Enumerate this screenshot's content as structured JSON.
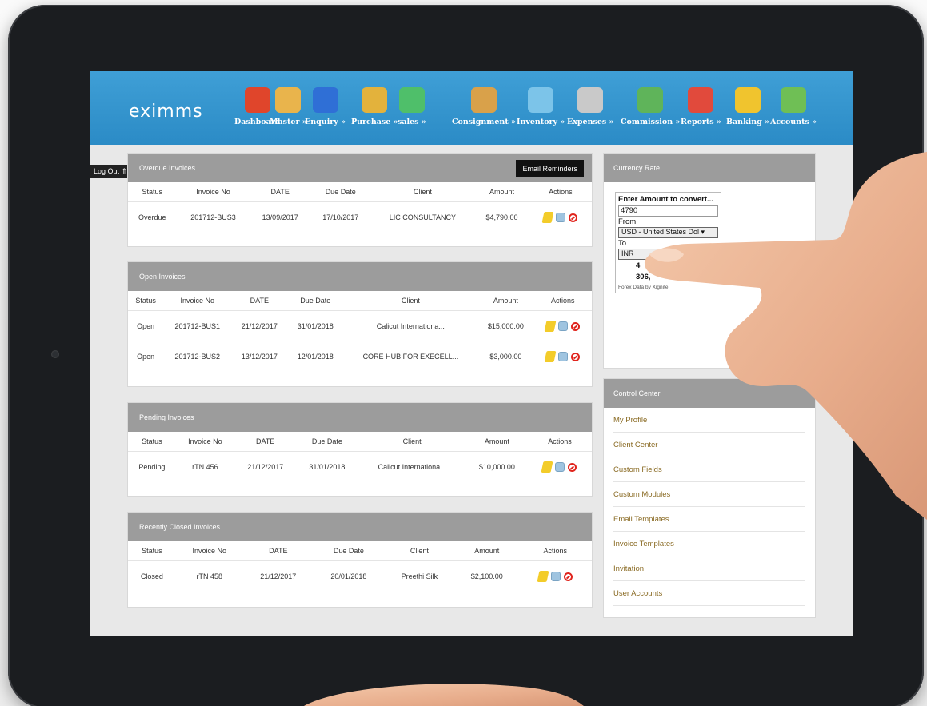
{
  "app": {
    "logo_text": "eximms",
    "logout_label": "Log Out ⇑"
  },
  "nav": [
    {
      "label": "Dashboard",
      "icon": "house-icon",
      "color": "#e0452b"
    },
    {
      "label": "Master »",
      "icon": "operator-headset-icon",
      "color": "#e9b44c"
    },
    {
      "label": "Enquiry »",
      "icon": "cubes-icon",
      "color": "#2f6fd6"
    },
    {
      "label": "Purchase »",
      "icon": "box-icon",
      "color": "#e3b23c"
    },
    {
      "label": "sales »",
      "icon": "money-diamond-icon",
      "color": "#4fbf6a"
    },
    {
      "label": "Consignment »",
      "icon": "package-icon",
      "color": "#d9a14a"
    },
    {
      "label": "Inventory »",
      "icon": "bar-chart-icon",
      "color": "#7cc4e9"
    },
    {
      "label": "Expenses »",
      "icon": "coin-magnifier-icon",
      "color": "#c9c9c9"
    },
    {
      "label": "Commission »",
      "icon": "money-stack-icon",
      "color": "#5fb45a"
    },
    {
      "label": "Reports »",
      "icon": "pie-chart-icon",
      "color": "#e14a3c"
    },
    {
      "label": "Banking »",
      "icon": "piggy-bank-icon",
      "color": "#f0c42e"
    },
    {
      "label": "Accounts »",
      "icon": "cash-icon",
      "color": "#6fbf55"
    }
  ],
  "columns": [
    "Status",
    "Invoice No",
    "DATE",
    "Due Date",
    "Client",
    "Amount",
    "Actions"
  ],
  "overdue": {
    "title": "Overdue Invoices",
    "button": "Email Reminders",
    "rows": [
      {
        "status": "Overdue",
        "invoice": "201712-BUS3",
        "date": "13/09/2017",
        "due": "17/10/2017",
        "client": "LIC CONSULTANCY",
        "amount": "$4,790.00"
      }
    ]
  },
  "open": {
    "title": "Open Invoices",
    "rows": [
      {
        "status": "Open",
        "invoice": "201712-BUS1",
        "date": "21/12/2017",
        "due": "31/01/2018",
        "client": "Calicut Internationa...",
        "amount": "$15,000.00"
      },
      {
        "status": "Open",
        "invoice": "201712-BUS2",
        "date": "13/12/2017",
        "due": "12/01/2018",
        "client": "CORE HUB FOR EXECELL...",
        "amount": "$3,000.00"
      }
    ]
  },
  "pending": {
    "title": "Pending Invoices",
    "rows": [
      {
        "status": "Pending",
        "invoice": "rTN 456",
        "date": "21/12/2017",
        "due": "31/01/2018",
        "client": "Calicut Internationa...",
        "amount": "$10,000.00"
      }
    ]
  },
  "closed": {
    "title": "Recently Closed Invoices",
    "rows": [
      {
        "status": "Closed",
        "invoice": "rTN 458",
        "date": "21/12/2017",
        "due": "20/01/2018",
        "client": "Preethi Silk",
        "amount": "$2,100.00"
      }
    ]
  },
  "currency": {
    "title": "Currency Rate",
    "prompt": "Enter Amount to convert...",
    "amount": "4790",
    "from_label": "From",
    "from_value": "USD - United States Dol ▾",
    "to_label": "To",
    "to_value": "INR",
    "result_line1": "4",
    "result_line2": "306,",
    "footer": "Forex Data by Xignite"
  },
  "control": {
    "title": "Control Center",
    "items": [
      "My Profile",
      "Client Center",
      "Custom Fields",
      "Custom Modules",
      "Email Templates",
      "Invoice Templates",
      "Invitation",
      "User Accounts"
    ]
  }
}
